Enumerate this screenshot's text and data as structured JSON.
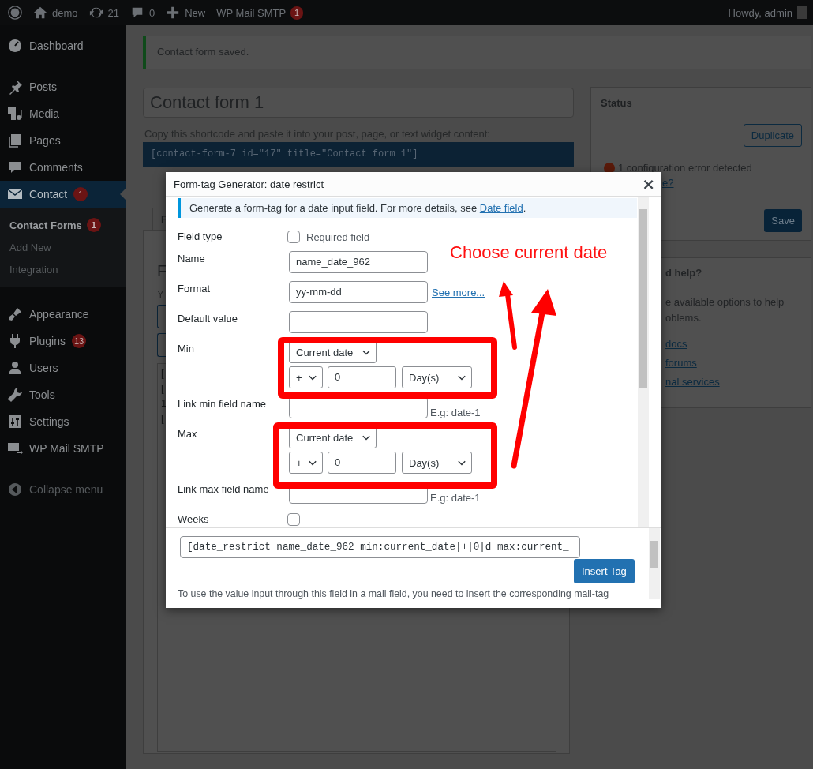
{
  "admin_bar": {
    "items": [
      {
        "kind": "logo"
      },
      {
        "kind": "home",
        "label": "demo"
      },
      {
        "kind": "updates",
        "label": "21"
      },
      {
        "kind": "comments",
        "label": "0"
      },
      {
        "kind": "new",
        "label": "New"
      },
      {
        "kind": "plain",
        "label": "WP Mail SMTP",
        "badge": "1"
      }
    ],
    "greeting": "Howdy, admin"
  },
  "sidebar": {
    "groups": [
      [
        {
          "label": "Dashboard",
          "selected": false
        }
      ],
      [
        {
          "label": "Posts",
          "selected": false
        },
        {
          "label": "Media",
          "selected": false
        },
        {
          "label": "Pages",
          "selected": false
        },
        {
          "label": "Comments",
          "selected": false
        },
        {
          "label": "Contact",
          "badge": "1",
          "selected": true,
          "children": [
            {
              "label": "Contact Forms",
              "badge": "1",
              "selected": true
            },
            {
              "label": "Add New",
              "selected": false
            },
            {
              "label": "Integration",
              "selected": false
            }
          ]
        }
      ],
      [
        {
          "label": "Appearance",
          "selected": false
        },
        {
          "label": "Plugins",
          "badge": "13",
          "selected": false
        },
        {
          "label": "Users",
          "selected": false
        },
        {
          "label": "Tools",
          "selected": false
        },
        {
          "label": "Settings",
          "selected": false
        },
        {
          "label": "WP Mail SMTP",
          "selected": false
        }
      ]
    ],
    "collapse": "Collapse menu"
  },
  "notice": {
    "text": "Contact form saved."
  },
  "editor": {
    "title": "Contact form 1",
    "shortcode_hint": "Copy this shortcode and paste it into your post, page, or text widget content:",
    "shortcode": "[contact-form-7 id=\"17\" title=\"Contact form 1\"]",
    "tab": "F",
    "heading": "F",
    "intro": "Y",
    "textarea_lines": [
      "[",
      "[",
      "1",
      "["
    ]
  },
  "status_box": {
    "title": "Status",
    "duplicate": "Duplicate",
    "error": "1 configuration error detected",
    "error_link": "e?",
    "save": "Save"
  },
  "help_box": {
    "title": "d help?",
    "text_lines": [
      "e available options to help",
      "oblems."
    ],
    "links": [
      "docs",
      "forums",
      "nal services"
    ]
  },
  "dialog": {
    "title": "Form-tag Generator: date restrict",
    "close": "×",
    "info": "Generate a form-tag for a date input field. For more details, see ",
    "info_link": "Date field",
    "info_end": ".",
    "rows": [
      {
        "kind": "checkbox",
        "label": "Field type",
        "option": "Required field",
        "checked": false
      },
      {
        "kind": "text",
        "label": "Name",
        "value": "name_date_962"
      },
      {
        "kind": "text",
        "label": "Format",
        "value": "yy-mm-dd",
        "link": "See more..."
      },
      {
        "kind": "text",
        "label": "Default value"
      },
      {
        "kind": "range",
        "label": "Min",
        "base": "Current date",
        "sign": "+",
        "amount": "0",
        "unit": "Day(s)"
      },
      {
        "kind": "text",
        "label": "Link min field name",
        "hint": "E.g: date-1"
      },
      {
        "kind": "range",
        "label": "Max",
        "base": "Current date",
        "sign": "+",
        "amount": "0",
        "unit": "Day(s)"
      },
      {
        "kind": "text",
        "label": "Link max field name",
        "hint": "E.g: date-1"
      },
      {
        "kind": "checkbox",
        "label": "Weeks",
        "checked": false
      }
    ],
    "tag": "[date_restrict name_date_962 min:current_date|+|0|d max:current_",
    "insert": "Insert Tag",
    "mail_note": "To use the value input through this field in a mail field, you need to insert the corresponding mail-tag"
  },
  "annotation": {
    "text": "Choose current date"
  }
}
